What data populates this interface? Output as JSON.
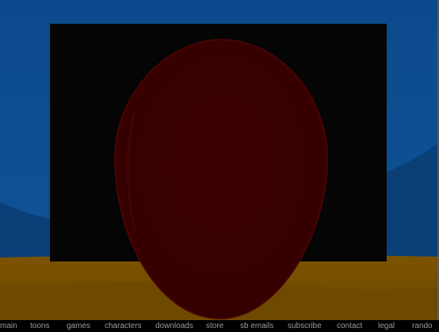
{
  "scene": {
    "sky_color": "#0E4F91",
    "ground_color": "#7A5300",
    "screen_color": "#050505",
    "egg_color": "#3A0000"
  },
  "nav": {
    "items": [
      {
        "label": "main"
      },
      {
        "label": "toons"
      },
      {
        "label": "games"
      },
      {
        "label": "characters"
      },
      {
        "label": "downloads"
      },
      {
        "label": "store"
      },
      {
        "label": "sb emails"
      },
      {
        "label": "subscribe"
      },
      {
        "label": "contact"
      },
      {
        "label": "legal"
      },
      {
        "label": "rando"
      }
    ]
  }
}
